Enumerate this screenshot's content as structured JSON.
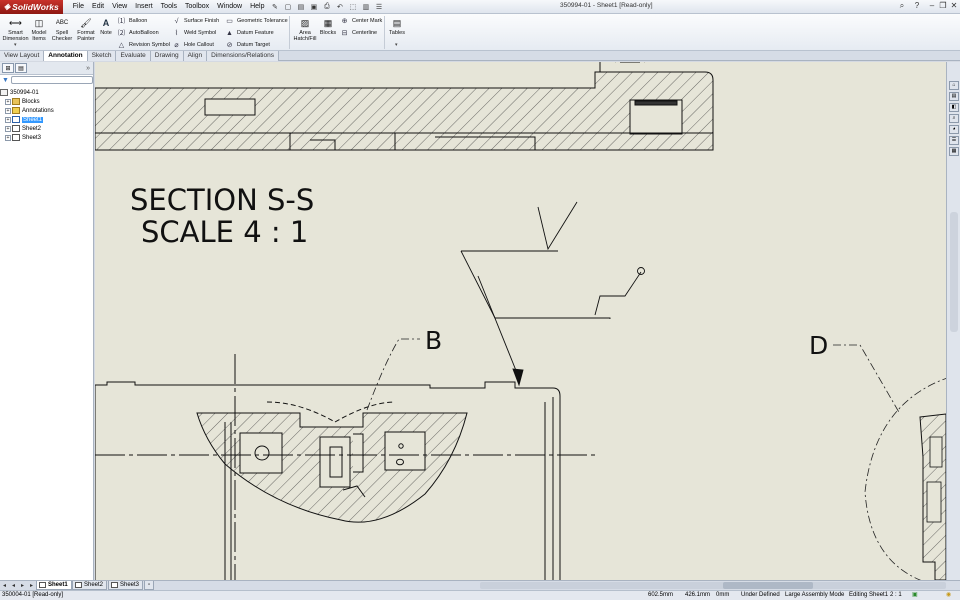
{
  "app": {
    "brand": "SolidWorks",
    "doc_title": "350994-01 - Sheet1 [Read-only]"
  },
  "menu": [
    "File",
    "Edit",
    "View",
    "Insert",
    "Tools",
    "Toolbox",
    "Window",
    "Help"
  ],
  "ribbon": {
    "smart_dimension": "Smart Dimension",
    "model_items": "Model Items",
    "spell_checker": "Spell Checker",
    "format_painter": "Format Painter",
    "note": "Note",
    "balloon": "Balloon",
    "autoballoon": "AutoBalloon",
    "revision_symbol": "Revision Symbol",
    "surface_finish": "Surface Finish",
    "weld_symbol": "Weld Symbol",
    "hole_callout": "Hole Callout",
    "geometric_tolerance": "Geometric Tolerance",
    "datum_feature": "Datum Feature",
    "datum_target": "Datum Target",
    "area_hatch": "Area Hatch/Fill",
    "blocks": "Blocks",
    "center_mark": "Center Mark",
    "centerline": "Centerline",
    "tables": "Tables"
  },
  "cm_tabs": [
    {
      "label": "View Layout",
      "active": false
    },
    {
      "label": "Annotation",
      "active": true
    },
    {
      "label": "Sketch",
      "active": false
    },
    {
      "label": "Evaluate",
      "active": false
    },
    {
      "label": "Drawing",
      "active": false
    },
    {
      "label": "Align",
      "active": false
    },
    {
      "label": "Dimensions/Relations",
      "active": false
    }
  ],
  "tree": {
    "root": "350994-01",
    "items": [
      "Blocks",
      "Annotations",
      "Sheet1",
      "Sheet2",
      "Sheet3"
    ]
  },
  "drawing": {
    "section_title": "SECTION S-S",
    "section_scale": "SCALE 4 : 1",
    "label_b": "B",
    "label_d": "D"
  },
  "sheets": [
    {
      "label": "Sheet1",
      "active": true
    },
    {
      "label": "Sheet2",
      "active": false
    },
    {
      "label": "Sheet3",
      "active": false
    }
  ],
  "status": {
    "file": "350004-01 [Read-only]",
    "x": "602.5mm",
    "y": "426.1mm",
    "z": "0mm",
    "state": "Under Defined",
    "mode": "Large Assembly Mode",
    "editing": "Editing Sheet1",
    "scale": "2 : 1"
  },
  "colors": {
    "canvas": "#e6e5d8",
    "brand_red": "#c9322b",
    "selection": "#3399ff"
  }
}
